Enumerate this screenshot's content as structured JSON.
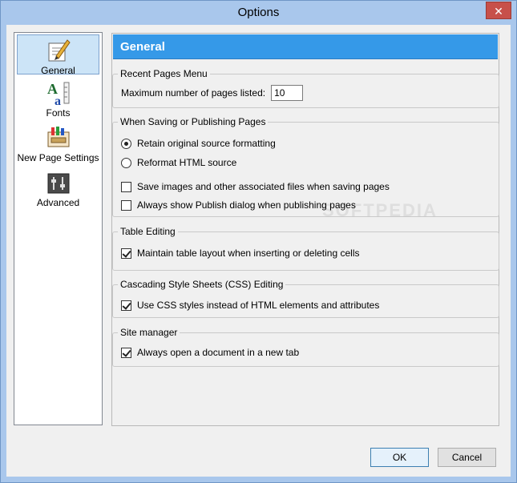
{
  "window": {
    "title": "Options",
    "close_glyph": "✕"
  },
  "sidebar": {
    "items": [
      {
        "label": "General",
        "icon": "pen-paper-icon",
        "selected": true
      },
      {
        "label": "Fonts",
        "icon": "font-icon",
        "selected": false
      },
      {
        "label": "New Page Settings",
        "icon": "paint-settings-icon",
        "selected": false
      },
      {
        "label": "Advanced",
        "icon": "advanced-settings-icon",
        "selected": false
      }
    ]
  },
  "panel": {
    "header": "General",
    "groups": {
      "recent": {
        "title": "Recent Pages Menu",
        "max_label": "Maximum number of pages listed:",
        "max_value": "10"
      },
      "saving": {
        "title": "When Saving or Publishing Pages",
        "retain_label": "Retain original source formatting",
        "reformat_label": "Reformat HTML source",
        "save_images_label": "Save images and other associated files when saving pages",
        "publish_dialog_label": "Always show Publish dialog when publishing pages"
      },
      "table": {
        "title": "Table Editing",
        "maintain_label": "Maintain table layout when inserting or deleting cells"
      },
      "css": {
        "title": "Cascading Style Sheets (CSS) Editing",
        "use_css_label": "Use CSS styles instead of HTML elements and attributes"
      },
      "site": {
        "title": "Site manager",
        "new_tab_label": "Always open a document in a new tab"
      }
    }
  },
  "buttons": {
    "ok": "OK",
    "cancel": "Cancel"
  },
  "colors": {
    "accent": "#3599e8",
    "titlebar": "#a9c7ec",
    "close": "#c7504a"
  },
  "watermark": "SOFTPEDIA"
}
